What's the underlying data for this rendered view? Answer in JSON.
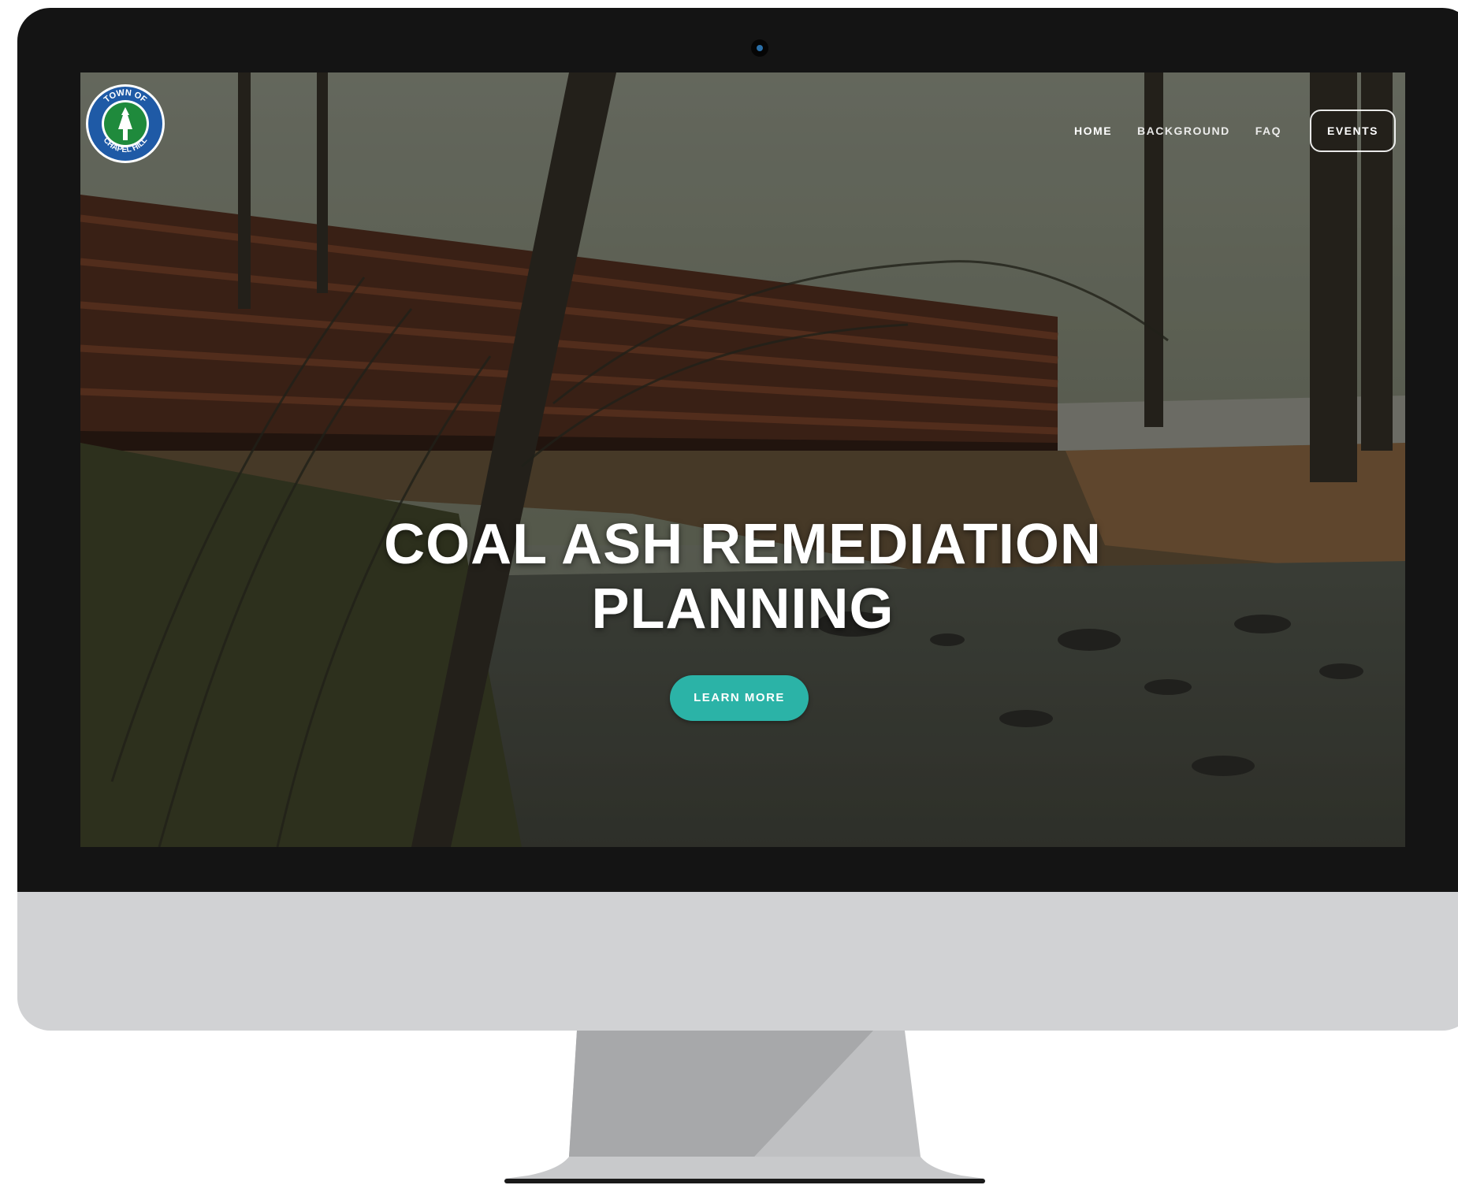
{
  "site": {
    "logo": {
      "top_text": "TOWN OF",
      "bottom_text": "CHAPEL HILL"
    },
    "nav": {
      "items": [
        {
          "label": "HOME",
          "active": true
        },
        {
          "label": "BACKGROUND",
          "active": false
        },
        {
          "label": "FAQ",
          "active": false
        }
      ],
      "events_button": "EVENTS"
    },
    "hero": {
      "title_line1": "COAL ASH REMEDIATION",
      "title_line2": "PLANNING",
      "cta_label": "LEARN MORE"
    }
  },
  "colors": {
    "accent": "#2bb3a7",
    "bezel": "#141414",
    "chin": "#d1d2d4",
    "logo_blue": "#1f5aa6",
    "logo_green": "#1f8a3c"
  }
}
